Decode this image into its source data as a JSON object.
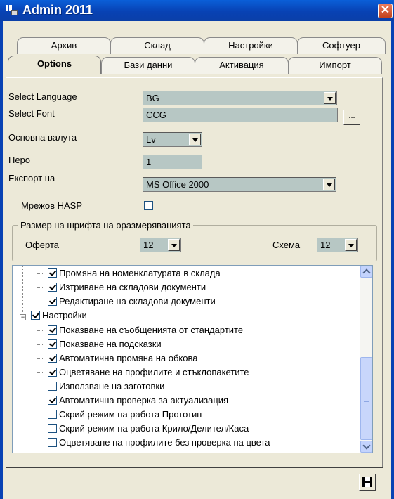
{
  "window": {
    "title": "Admin 2011",
    "close_label": "✕"
  },
  "tabs_row1": [
    {
      "label": "Архив"
    },
    {
      "label": "Склад"
    },
    {
      "label": "Настройки"
    },
    {
      "label": "Софтуер"
    }
  ],
  "tabs_row2": [
    {
      "label": "Options",
      "active": true
    },
    {
      "label": "Бази данни"
    },
    {
      "label": "Активация"
    },
    {
      "label": "Импорт"
    }
  ],
  "form": {
    "language": {
      "label": "Select Language",
      "value": "BG"
    },
    "font": {
      "label": "Select Font",
      "value": "CCG",
      "browse_label": "..."
    },
    "currency": {
      "label": "Основна валута",
      "value": "Lv"
    },
    "pero": {
      "label": "Перо",
      "value": "1"
    },
    "export": {
      "label": "Експорт на",
      "value": "MS Office 2000"
    },
    "hasp": {
      "label": "Мрежов HASP",
      "checked": false
    }
  },
  "font_size_group": {
    "title": "Размер на шрифта на оразмеряванията",
    "offer_label": "Оферта",
    "offer_value": "12",
    "scheme_label": "Схема",
    "scheme_value": "12"
  },
  "tree": {
    "items": [
      {
        "label": "Промяна на номенклатурата в склада",
        "checked": true
      },
      {
        "label": "Изтриване на складови документи",
        "checked": true
      },
      {
        "label": "Редактиране на складови документи",
        "checked": true
      },
      {
        "label": "Настройки",
        "checked": true,
        "parent": true
      },
      {
        "label": "Показване на съобщенията от стандартите",
        "checked": true
      },
      {
        "label": "Показване на подсказки",
        "checked": true
      },
      {
        "label": "Автоматична промяна на обкова",
        "checked": true
      },
      {
        "label": "Оцветяване на профилите и стъклопакетите",
        "checked": true
      },
      {
        "label": "Използване на заготовки",
        "checked": false
      },
      {
        "label": "Автоматична проверка за актуализация",
        "checked": true
      },
      {
        "label": "Скрий режим на работа Прототип",
        "checked": false
      },
      {
        "label": "Скрий режим на работа Крило/Делител/Каса",
        "checked": false
      },
      {
        "label": "Оцветяване на профилите без проверка на цвета",
        "checked": false
      }
    ]
  },
  "icons": {
    "save": "save-icon",
    "app": "app-icon"
  }
}
